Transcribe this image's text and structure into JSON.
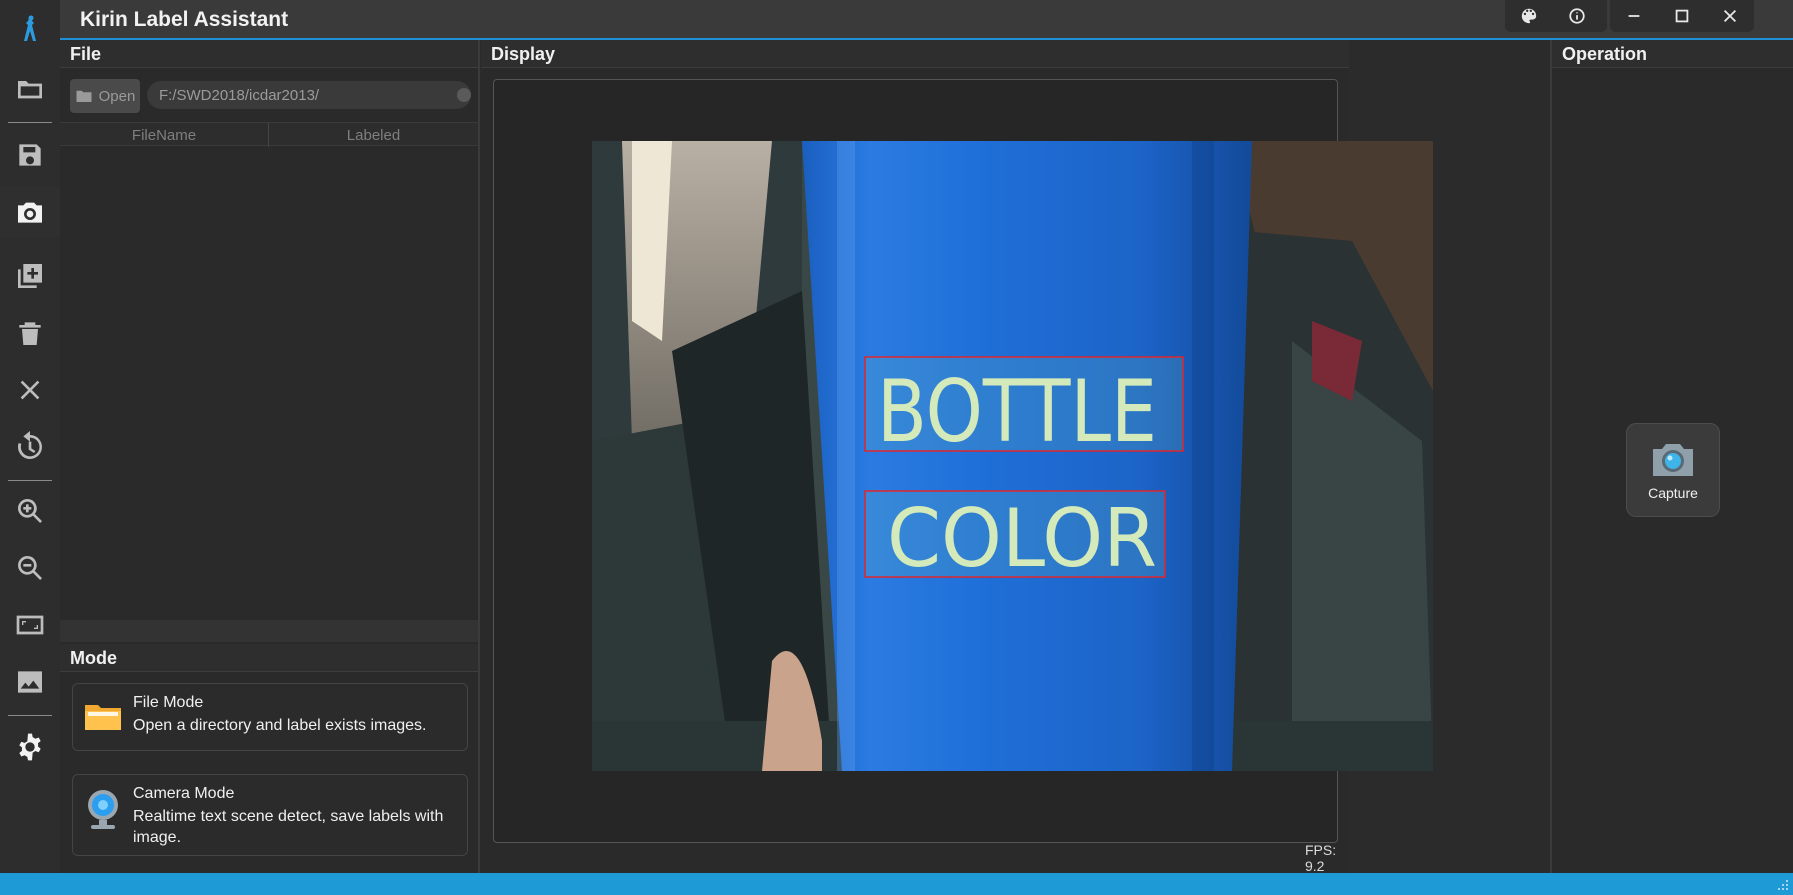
{
  "app": {
    "title": "Kirin Label Assistant"
  },
  "sidebar": {
    "items": [
      {
        "icon": "app-logo-icon"
      },
      {
        "icon": "folder-icon"
      },
      {
        "icon": "save-icon"
      },
      {
        "icon": "camera-icon"
      },
      {
        "icon": "add-image-icon"
      },
      {
        "icon": "trash-icon"
      },
      {
        "icon": "close-icon"
      },
      {
        "icon": "history-icon"
      },
      {
        "icon": "zoom-in-icon"
      },
      {
        "icon": "zoom-out-icon"
      },
      {
        "icon": "fit-screen-icon"
      },
      {
        "icon": "image-icon"
      },
      {
        "icon": "settings-icon"
      }
    ]
  },
  "panels": {
    "file": "File",
    "display": "Display",
    "operation": "Operation",
    "mode": "Mode"
  },
  "file": {
    "open_label": "Open",
    "path": "F:/SWD2018/icdar2013/",
    "columns": [
      "FileName",
      "Labeled"
    ]
  },
  "modes": [
    {
      "title": "File Mode",
      "desc": "Open a directory and label exists images."
    },
    {
      "title": "Camera Mode",
      "desc": "Realtime text scene detect, save labels with image."
    }
  ],
  "display": {
    "fps": "FPS: 9.2",
    "detections": [
      "BOTTLE",
      "COLOR"
    ]
  },
  "operation": {
    "capture_label": "Capture"
  },
  "colors": {
    "accent": "#1e9ad6",
    "box": "#e0262b",
    "bottle": "#1f6fd1",
    "text_handwriting": "#e9f2bc"
  }
}
